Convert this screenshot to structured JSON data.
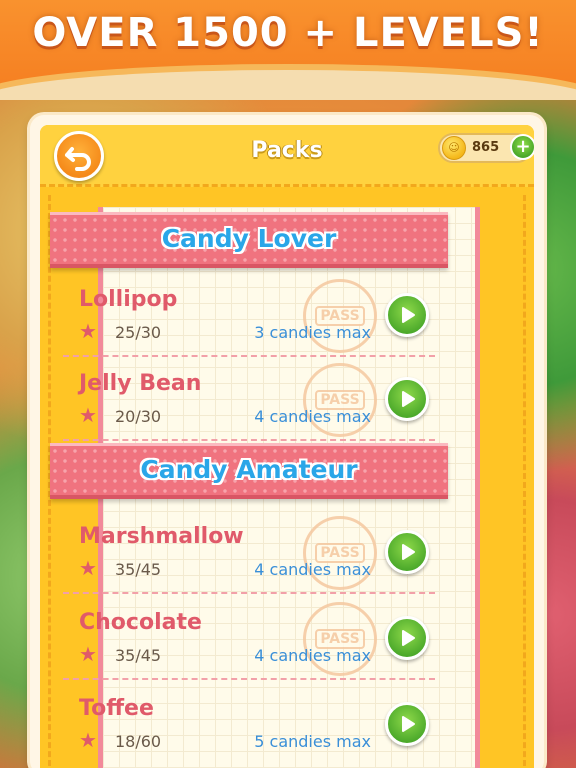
{
  "banner": {
    "title": "OVER 1500 + LEVELS!"
  },
  "header": {
    "title": "Packs",
    "coins": "865",
    "plus": "+"
  },
  "sections": [
    {
      "title": "Candy Lover",
      "packs": [
        {
          "name": "Lollipop",
          "progress": "25/30",
          "max": "3 candies max",
          "stamp": "PASS"
        },
        {
          "name": "Jelly Bean",
          "progress": "20/30",
          "max": "4 candies max",
          "stamp": "PASS"
        }
      ]
    },
    {
      "title": "Candy Amateur",
      "packs": [
        {
          "name": "Marshmallow",
          "progress": "35/45",
          "max": "4 candies max",
          "stamp": "PASS"
        },
        {
          "name": "Chocolate",
          "progress": "35/45",
          "max": "4 candies max",
          "stamp": "PASS"
        },
        {
          "name": "Toffee",
          "progress": "18/60",
          "max": "5 candies max"
        }
      ]
    }
  ],
  "icons": {
    "back": "back-arrow-icon",
    "coin": "smiley-coin-icon",
    "star": "star-icon",
    "play": "play-icon"
  },
  "colors": {
    "banner": "#f57d20",
    "panel": "#ffc525",
    "ribbon": "#f0737f",
    "section_title": "#2aa6e8",
    "pack_name": "#e05a6a",
    "max_text": "#3a8fd8",
    "play_button": "#4aa82a"
  }
}
